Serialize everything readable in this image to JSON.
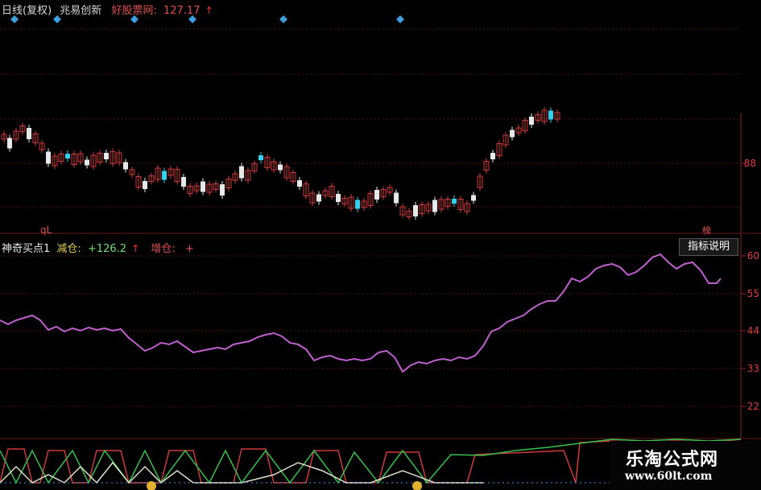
{
  "header": {
    "period": "日线(复权)",
    "stock": "兆易创新",
    "site": "好股票网:",
    "price": "127.17",
    "arrow": "↑"
  },
  "indicator_header": {
    "name": "神奇买点1",
    "metric": "减仓:",
    "metric_value": "+126.2",
    "arrow": "↑",
    "add_label": "增仓:",
    "add_value": "+"
  },
  "ql_tag": "qL",
  "price_axis": {
    "label": "88"
  },
  "indicator_axis": {
    "labels": [
      "60",
      "55",
      "44",
      "33",
      "22"
    ]
  },
  "buttons": {
    "indicator_help": "指标说明"
  },
  "side_tags": {
    "top": "榜"
  },
  "watermark": {
    "title": "乐淘公式网",
    "url": "www.60lt.com"
  },
  "colors": {
    "bull": "#d03a3a",
    "bear": "#2fd0f0",
    "indicator_line": "#c060d0",
    "grid": "#5a1010"
  }
}
